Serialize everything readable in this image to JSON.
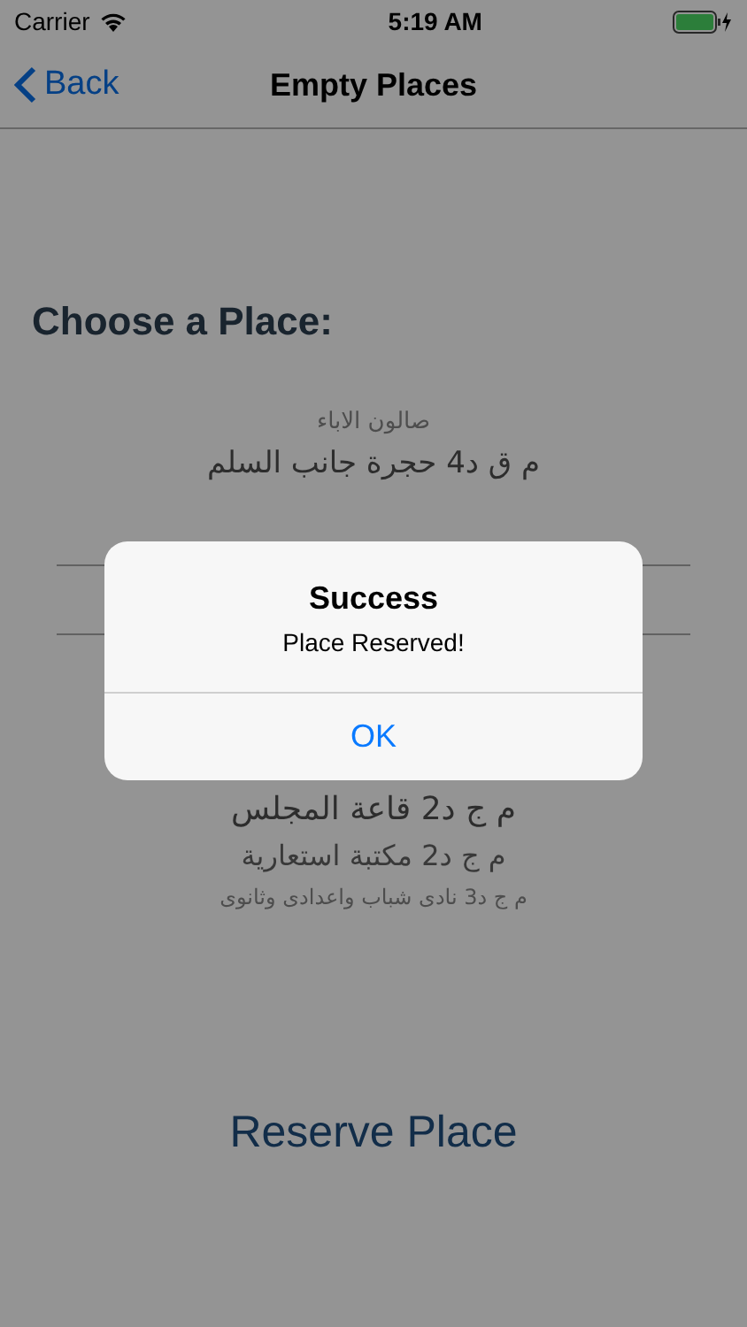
{
  "status_bar": {
    "carrier": "Carrier",
    "time": "5:19 AM"
  },
  "nav_bar": {
    "back": "Back",
    "title": "Empty Places"
  },
  "heading": "Choose a Place:",
  "picker": {
    "rows_above": [
      "صالون الاباء",
      "م ق د4 حجرة جانب السلم"
    ],
    "rows_below": [
      "م ج د2 قاعة المجلس",
      "م ج د2 مكتبة استعارية",
      "م ج د3 نادى شباب واعدادى وثانوى"
    ]
  },
  "reserve_button": "Reserve Place",
  "alert": {
    "title": "Success",
    "message": "Place Reserved!",
    "button": "OK"
  }
}
